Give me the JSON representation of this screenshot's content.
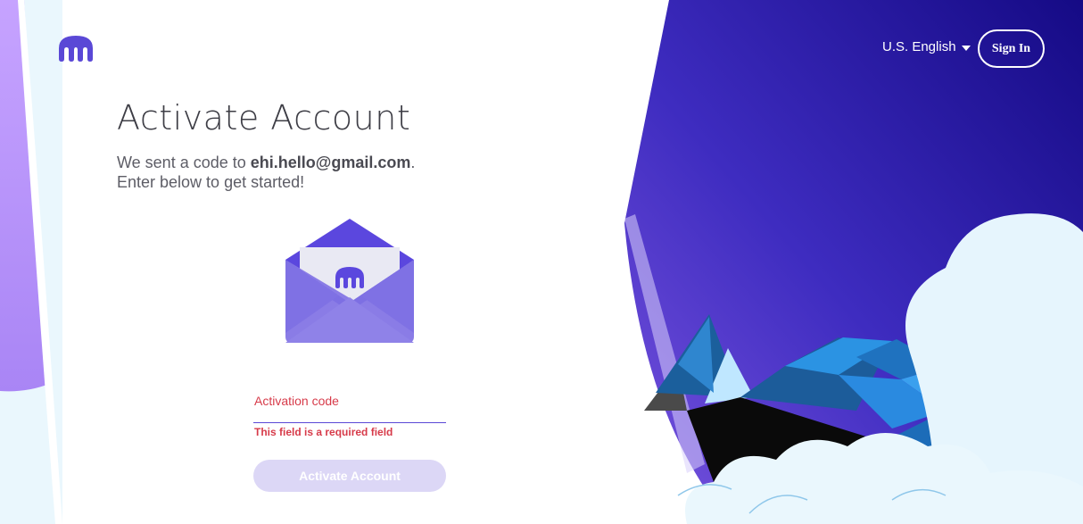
{
  "header": {
    "language": "U.S. English",
    "sign_in_label": "Sign In"
  },
  "main": {
    "title": "Activate Account",
    "subtitle_prefix": "We sent a code to ",
    "email": "ehi.hello@gmail.com",
    "subtitle_suffix": ".",
    "subtitle_line2": "Enter below to get started!",
    "field_label": "Activation code",
    "field_value": "",
    "error_message": "This field is a required field",
    "submit_label": "Activate Account"
  },
  "icons": {
    "logo": "kraken-logo-icon",
    "envelope": "envelope-icon",
    "language_caret": "caret-down-icon"
  },
  "colors": {
    "brand": "#5a48d6",
    "error": "#d73b4a",
    "button_disabled": "#dcd7f6",
    "sky_dark": "#1c0d8a"
  }
}
